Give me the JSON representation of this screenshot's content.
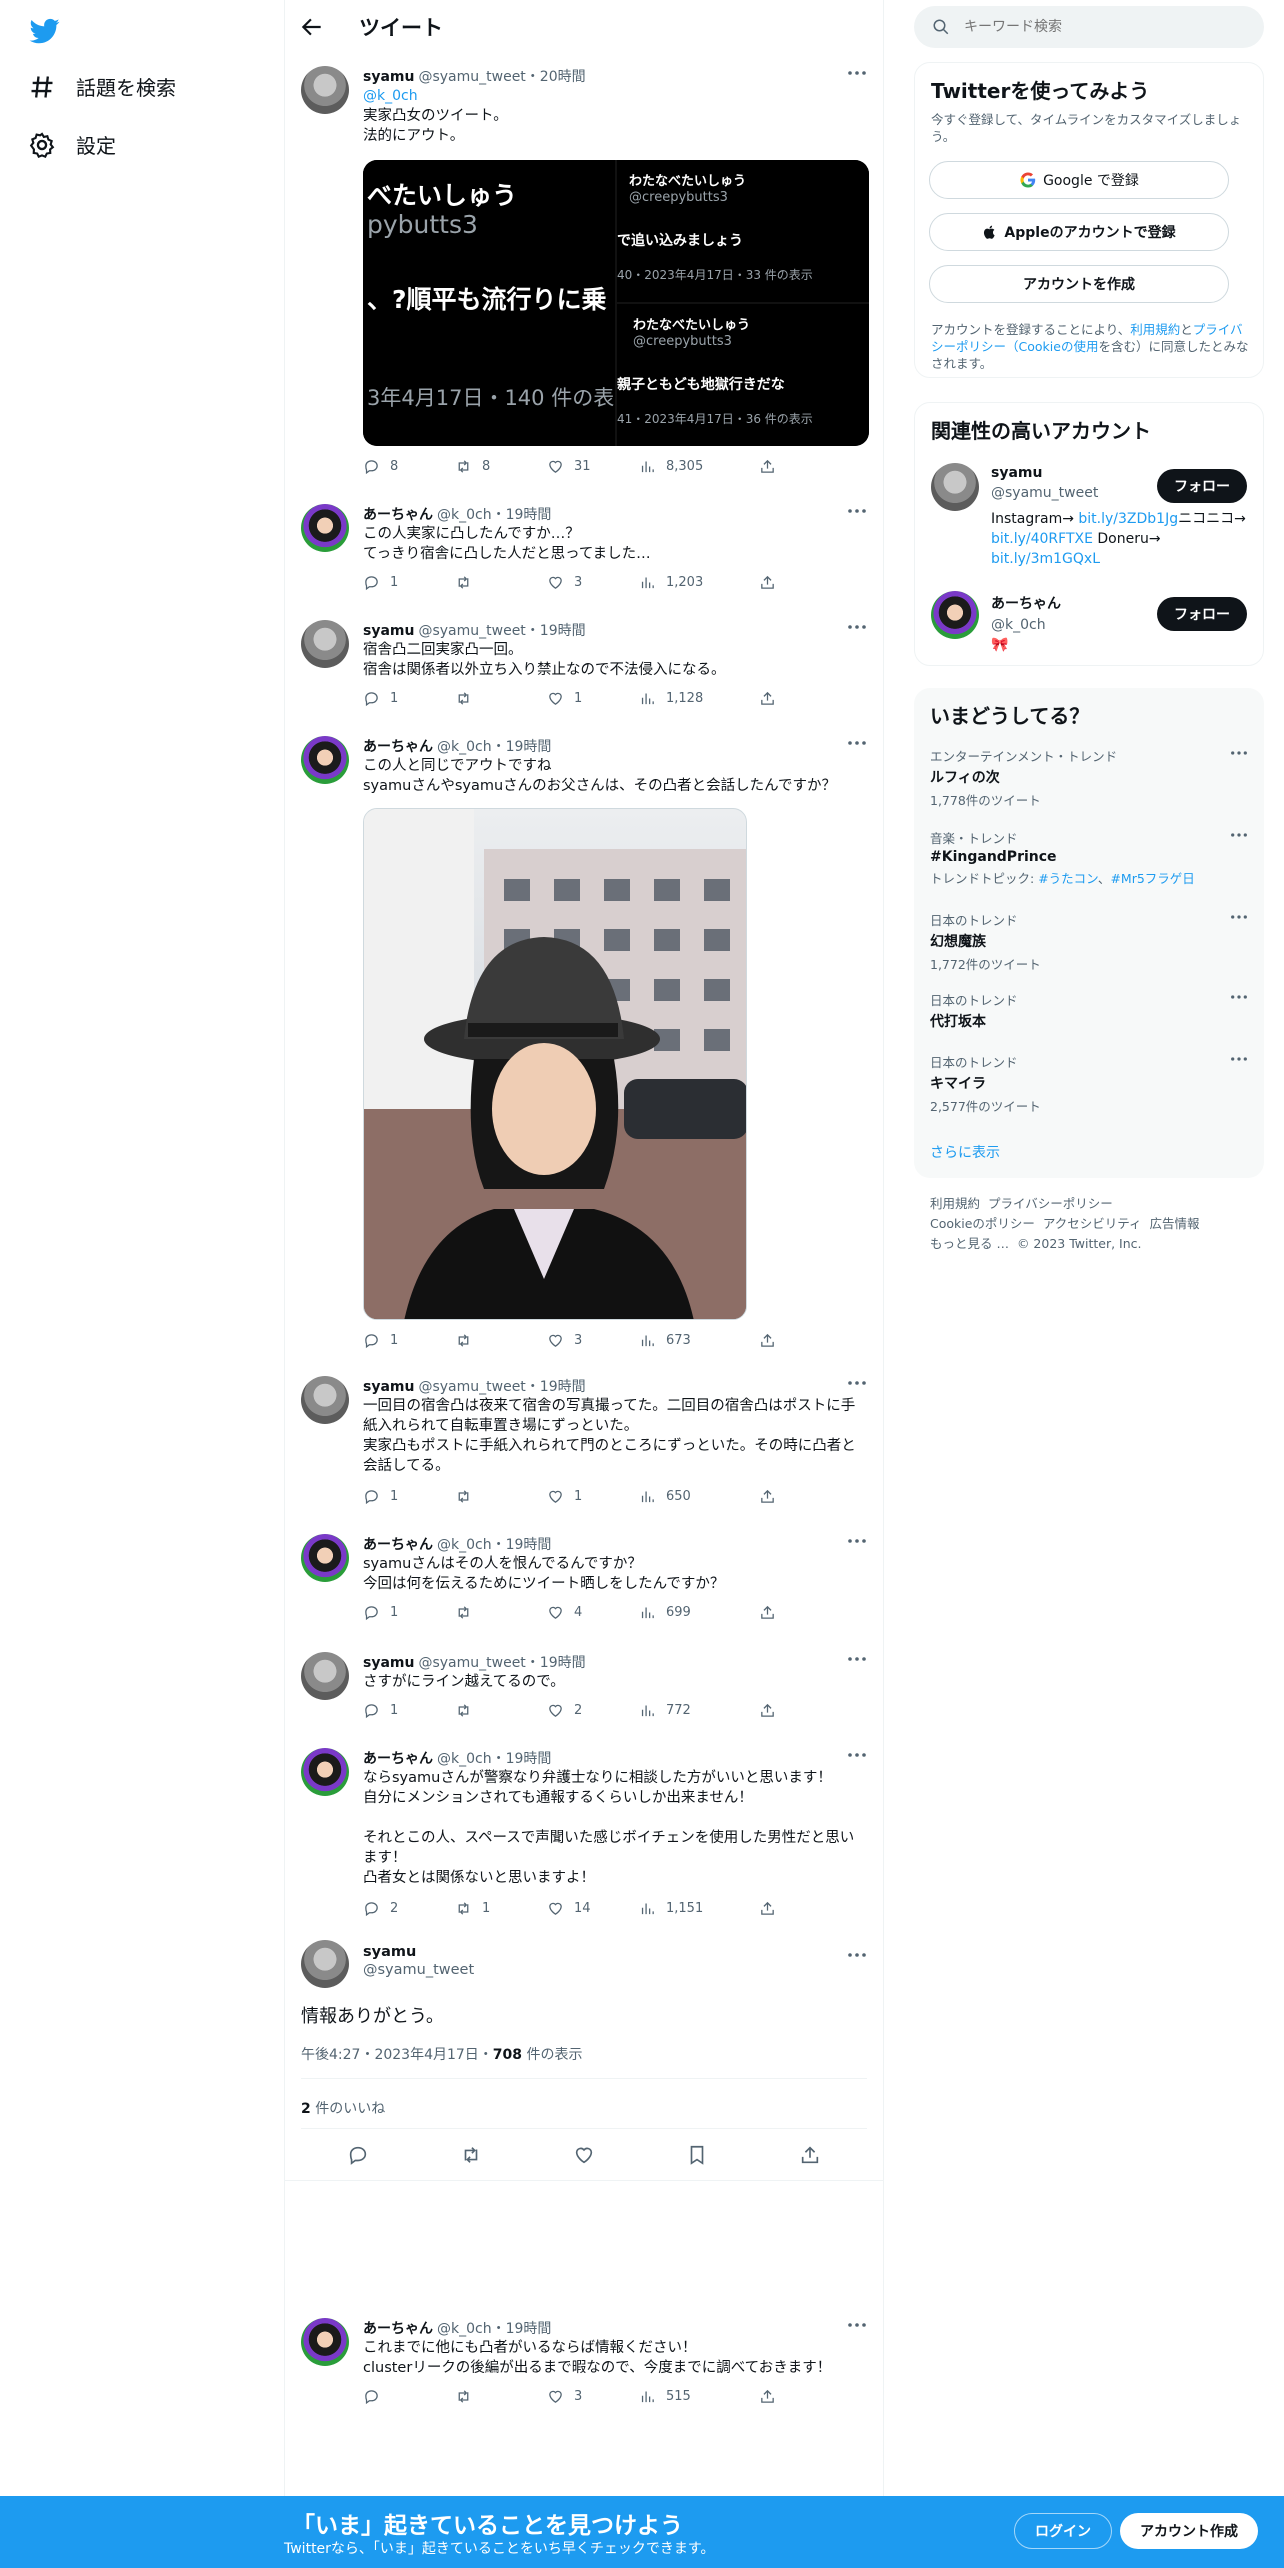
{
  "nav": {
    "explore": "話題を検索",
    "settings": "設定"
  },
  "header": {
    "title": "ツイート"
  },
  "tweets": [
    {
      "name": "syamu",
      "handle": "@syamu_tweet",
      "time": "・20時間",
      "reply_to": "@k_0ch",
      "text": "実家凸女のツイート。\n法的にアウト。",
      "embeds": {
        "left_lines": [
          "べたいしゅう",
          "pybutts3",
          "、?順平も流行りに乗",
          "3年4月17日・140 件の表"
        ],
        "tr_name": "わたなべたいしゅう",
        "tr_handle": "@creepybutts3",
        "tr_text": "で追い込みましょう",
        "tr_meta": "40・2023年4月17日・33 件の表示",
        "br_name": "わたなべたいしゅう",
        "br_handle": "@creepybutts3",
        "br_text": "親子ともども地獄行きだな",
        "br_meta": "41・2023年4月17日・36 件の表示"
      },
      "stats": {
        "reply": "8",
        "retweet": "8",
        "like": "31",
        "views": "8,305"
      }
    },
    {
      "name": "あーちゃん",
      "handle": "@k_0ch",
      "time": "・19時間",
      "text": "この人実家に凸したんですか…？\nてっきり宿舎に凸した人だと思ってました…",
      "stats": {
        "reply": "1",
        "retweet": "",
        "like": "3",
        "views": "1,203"
      }
    },
    {
      "name": "syamu",
      "handle": "@syamu_tweet",
      "time": "・19時間",
      "text": "宿舎凸二回実家凸一回。\n宿舎は関係者以外立ち入り禁止なので不法侵入になる。",
      "stats": {
        "reply": "1",
        "retweet": "",
        "like": "1",
        "views": "1,128"
      }
    },
    {
      "name": "あーちゃん",
      "handle": "@k_0ch",
      "time": "・19時間",
      "text": "この人と同じでアウトですね\nsyamuさんやsyamuさんのお父さんは、その凸者と会話したんですか？",
      "stats": {
        "reply": "1",
        "retweet": "",
        "like": "3",
        "views": "673"
      }
    },
    {
      "name": "syamu",
      "handle": "@syamu_tweet",
      "time": "・19時間",
      "text": "一回目の宿舎凸は夜来て宿舎の写真撮ってた。二回目の宿舎凸はポストに手紙入れられて自転車置き場にずっといた。\n実家凸もポストに手紙入れられて門のところにずっといた。その時に凸者と会話してる。",
      "stats": {
        "reply": "1",
        "retweet": "",
        "like": "1",
        "views": "650"
      }
    },
    {
      "name": "あーちゃん",
      "handle": "@k_0ch",
      "time": "・19時間",
      "text": "syamuさんはその人を恨んでるんですか？\n今回は何を伝えるためにツイート晒しをしたんですか？",
      "stats": {
        "reply": "1",
        "retweet": "",
        "like": "4",
        "views": "699"
      }
    },
    {
      "name": "syamu",
      "handle": "@syamu_tweet",
      "time": "・19時間",
      "text": "さすがにライン越えてるので。",
      "stats": {
        "reply": "1",
        "retweet": "",
        "like": "2",
        "views": "772"
      }
    },
    {
      "name": "あーちゃん",
      "handle": "@k_0ch",
      "time": "・19時間",
      "text": "ならsyamuさんが警察なり弁護士なりに相談した方がいいと思います！\n自分にメンションされても通報するくらいしか出来ません！\n\nそれとこの人、スペースで声聞いた感じボイチェンを使用した男性だと思います！\n凸者女とは関係ないと思いますよ！",
      "stats": {
        "reply": "2",
        "retweet": "1",
        "like": "14",
        "views": "1,151"
      }
    }
  ],
  "focus": {
    "name": "syamu",
    "handle": "@syamu_tweet",
    "text": "情報ありがとう。",
    "time": "午後4:27・2023年4月17日・",
    "views_num": "708",
    "views_label": " 件の表示",
    "likes_num": "2",
    "likes_label": " 件のいいね"
  },
  "last_reply": {
    "name": "あーちゃん",
    "handle": "@k_0ch",
    "time": "・19時間",
    "text": "これまでに他にも凸者がいるならば情報ください！\nclusterリークの後編が出るまで暇なので、今度までに調べておきます！",
    "stats": {
      "reply": "",
      "retweet": "",
      "like": "3",
      "views": "515"
    }
  },
  "search": {
    "placeholder": "キーワード検索"
  },
  "signup_card": {
    "title": "Twitterを使ってみよう",
    "desc": "今すぐ登録して、タイムラインをカスタマイズしましょう。",
    "google": "Google で登録",
    "apple": "Appleのアカウントで登録",
    "create": "アカウントを作成",
    "legal_pre": "アカウントを登録することにより、",
    "legal_terms": "利用規約",
    "legal_and": "と",
    "legal_privacy": "プライバシーポリシー",
    "legal_cookie": "（Cookieの使用",
    "legal_post": "を含む）に同意したとみなされます。"
  },
  "relevant": {
    "title": "関連性の高いアカウント",
    "accounts": [
      {
        "name": "syamu",
        "handle": "@syamu_tweet",
        "bio_1": "Instagram→ ",
        "link_1": "bit.ly/3ZDb1Jg",
        "bio_2": "ニコニコ→ ",
        "link_2": "bit.ly/40RFTXE",
        "bio_3": " Doneru→ ",
        "link_3": "bit.ly/3m1GQxL",
        "follow": "フォロー"
      },
      {
        "name": "あーちゃん",
        "handle": "@k_0ch",
        "bio": "🎀",
        "follow": "フォロー"
      }
    ]
  },
  "trends": {
    "title": "いまどうしてる？",
    "items": [
      {
        "cat": "エンターテインメント・トレンド",
        "name": "ルフィの次",
        "count": "1,778件のツイート"
      },
      {
        "cat": "音楽・トレンド",
        "name": "#KingandPrince",
        "topic_label": "トレンドトピック: ",
        "topic_1": "#うたコン",
        "topic_sep": "、",
        "topic_2": "#Mr5フラゲ日"
      },
      {
        "cat": "日本のトレンド",
        "name": "幻想魔族",
        "count": "1,772件のツイート"
      },
      {
        "cat": "日本のトレンド",
        "name": "代打坂本",
        "count": ""
      },
      {
        "cat": "日本のトレンド",
        "name": "キマイラ",
        "count": "2,577件のツイート"
      }
    ],
    "more": "さらに表示"
  },
  "footer": {
    "terms": "利用規約",
    "privacy": "プライバシーポリシー",
    "cookie": "Cookieのポリシー",
    "access": "アクセシビリティ",
    "ads": "広告情報",
    "more": "もっと見る …",
    "copy": "© 2023 Twitter, Inc."
  },
  "bottom": {
    "title": "「いま」起きていることを見つけよう",
    "sub": "Twitterなら、「いま」起きていることをいち早くチェックできます。",
    "login": "ログイン",
    "signup": "アカウント作成"
  },
  "colors": {
    "accent": "#1d9bf0",
    "text": "#0f1419",
    "muted": "#536471"
  }
}
